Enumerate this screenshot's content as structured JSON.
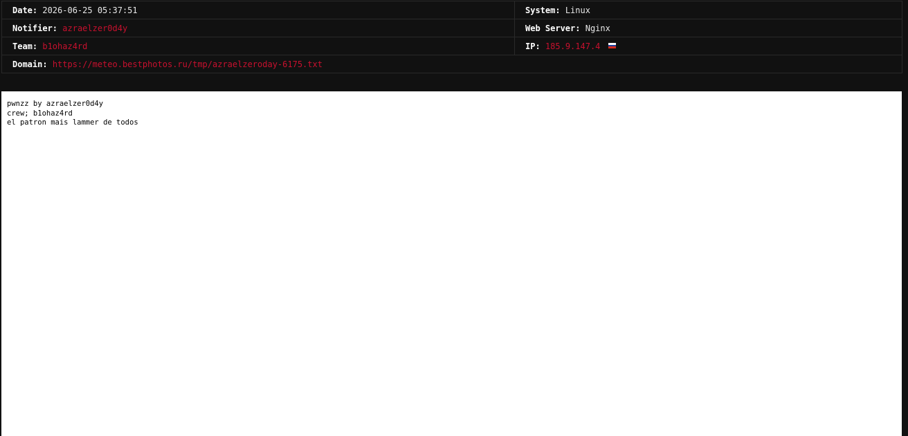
{
  "info": {
    "date_label": "Date:",
    "date_value": "2026-06-25 05:37:51",
    "system_label": "System:",
    "system_value": "Linux",
    "notifier_label": "Notifier:",
    "notifier_value": "azraelzer0d4y",
    "webserver_label": "Web Server:",
    "webserver_value": "Nginx",
    "team_label": "Team:",
    "team_value": "b1ohaz4rd",
    "ip_label": "IP:",
    "ip_value": "185.9.147.4",
    "ip_flag_icon": "russia-flag-icon",
    "domain_label": "Domain:",
    "domain_value": "https://meteo.bestphotos.ru/tmp/azraelzeroday-6175.txt"
  },
  "mirror": {
    "lines": [
      "pwnzz by azraelzer0d4y",
      "crew; b1ohaz4rd",
      "el patron mais lammer de todos"
    ]
  },
  "colors": {
    "background": "#111111",
    "accent_red": "#c8102e",
    "border": "#2a2a2a",
    "mirror_bg": "#ffffff"
  }
}
